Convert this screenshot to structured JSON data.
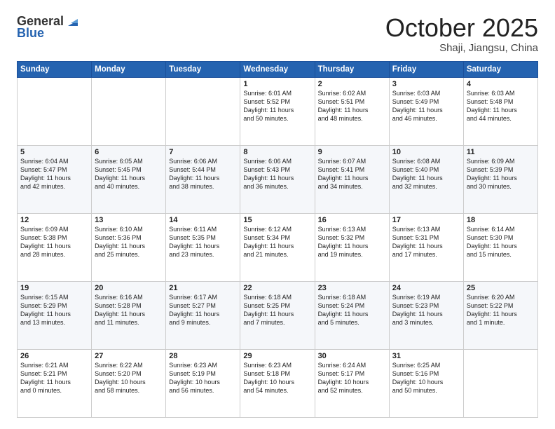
{
  "header": {
    "logo_general": "General",
    "logo_blue": "Blue",
    "month": "October 2025",
    "location": "Shaji, Jiangsu, China"
  },
  "days_of_week": [
    "Sunday",
    "Monday",
    "Tuesday",
    "Wednesday",
    "Thursday",
    "Friday",
    "Saturday"
  ],
  "weeks": [
    [
      {
        "day": "",
        "info": ""
      },
      {
        "day": "",
        "info": ""
      },
      {
        "day": "",
        "info": ""
      },
      {
        "day": "1",
        "info": "Sunrise: 6:01 AM\nSunset: 5:52 PM\nDaylight: 11 hours\nand 50 minutes."
      },
      {
        "day": "2",
        "info": "Sunrise: 6:02 AM\nSunset: 5:51 PM\nDaylight: 11 hours\nand 48 minutes."
      },
      {
        "day": "3",
        "info": "Sunrise: 6:03 AM\nSunset: 5:49 PM\nDaylight: 11 hours\nand 46 minutes."
      },
      {
        "day": "4",
        "info": "Sunrise: 6:03 AM\nSunset: 5:48 PM\nDaylight: 11 hours\nand 44 minutes."
      }
    ],
    [
      {
        "day": "5",
        "info": "Sunrise: 6:04 AM\nSunset: 5:47 PM\nDaylight: 11 hours\nand 42 minutes."
      },
      {
        "day": "6",
        "info": "Sunrise: 6:05 AM\nSunset: 5:45 PM\nDaylight: 11 hours\nand 40 minutes."
      },
      {
        "day": "7",
        "info": "Sunrise: 6:06 AM\nSunset: 5:44 PM\nDaylight: 11 hours\nand 38 minutes."
      },
      {
        "day": "8",
        "info": "Sunrise: 6:06 AM\nSunset: 5:43 PM\nDaylight: 11 hours\nand 36 minutes."
      },
      {
        "day": "9",
        "info": "Sunrise: 6:07 AM\nSunset: 5:41 PM\nDaylight: 11 hours\nand 34 minutes."
      },
      {
        "day": "10",
        "info": "Sunrise: 6:08 AM\nSunset: 5:40 PM\nDaylight: 11 hours\nand 32 minutes."
      },
      {
        "day": "11",
        "info": "Sunrise: 6:09 AM\nSunset: 5:39 PM\nDaylight: 11 hours\nand 30 minutes."
      }
    ],
    [
      {
        "day": "12",
        "info": "Sunrise: 6:09 AM\nSunset: 5:38 PM\nDaylight: 11 hours\nand 28 minutes."
      },
      {
        "day": "13",
        "info": "Sunrise: 6:10 AM\nSunset: 5:36 PM\nDaylight: 11 hours\nand 25 minutes."
      },
      {
        "day": "14",
        "info": "Sunrise: 6:11 AM\nSunset: 5:35 PM\nDaylight: 11 hours\nand 23 minutes."
      },
      {
        "day": "15",
        "info": "Sunrise: 6:12 AM\nSunset: 5:34 PM\nDaylight: 11 hours\nand 21 minutes."
      },
      {
        "day": "16",
        "info": "Sunrise: 6:13 AM\nSunset: 5:32 PM\nDaylight: 11 hours\nand 19 minutes."
      },
      {
        "day": "17",
        "info": "Sunrise: 6:13 AM\nSunset: 5:31 PM\nDaylight: 11 hours\nand 17 minutes."
      },
      {
        "day": "18",
        "info": "Sunrise: 6:14 AM\nSunset: 5:30 PM\nDaylight: 11 hours\nand 15 minutes."
      }
    ],
    [
      {
        "day": "19",
        "info": "Sunrise: 6:15 AM\nSunset: 5:29 PM\nDaylight: 11 hours\nand 13 minutes."
      },
      {
        "day": "20",
        "info": "Sunrise: 6:16 AM\nSunset: 5:28 PM\nDaylight: 11 hours\nand 11 minutes."
      },
      {
        "day": "21",
        "info": "Sunrise: 6:17 AM\nSunset: 5:27 PM\nDaylight: 11 hours\nand 9 minutes."
      },
      {
        "day": "22",
        "info": "Sunrise: 6:18 AM\nSunset: 5:25 PM\nDaylight: 11 hours\nand 7 minutes."
      },
      {
        "day": "23",
        "info": "Sunrise: 6:18 AM\nSunset: 5:24 PM\nDaylight: 11 hours\nand 5 minutes."
      },
      {
        "day": "24",
        "info": "Sunrise: 6:19 AM\nSunset: 5:23 PM\nDaylight: 11 hours\nand 3 minutes."
      },
      {
        "day": "25",
        "info": "Sunrise: 6:20 AM\nSunset: 5:22 PM\nDaylight: 11 hours\nand 1 minute."
      }
    ],
    [
      {
        "day": "26",
        "info": "Sunrise: 6:21 AM\nSunset: 5:21 PM\nDaylight: 11 hours\nand 0 minutes."
      },
      {
        "day": "27",
        "info": "Sunrise: 6:22 AM\nSunset: 5:20 PM\nDaylight: 10 hours\nand 58 minutes."
      },
      {
        "day": "28",
        "info": "Sunrise: 6:23 AM\nSunset: 5:19 PM\nDaylight: 10 hours\nand 56 minutes."
      },
      {
        "day": "29",
        "info": "Sunrise: 6:23 AM\nSunset: 5:18 PM\nDaylight: 10 hours\nand 54 minutes."
      },
      {
        "day": "30",
        "info": "Sunrise: 6:24 AM\nSunset: 5:17 PM\nDaylight: 10 hours\nand 52 minutes."
      },
      {
        "day": "31",
        "info": "Sunrise: 6:25 AM\nSunset: 5:16 PM\nDaylight: 10 hours\nand 50 minutes."
      },
      {
        "day": "",
        "info": ""
      }
    ]
  ]
}
